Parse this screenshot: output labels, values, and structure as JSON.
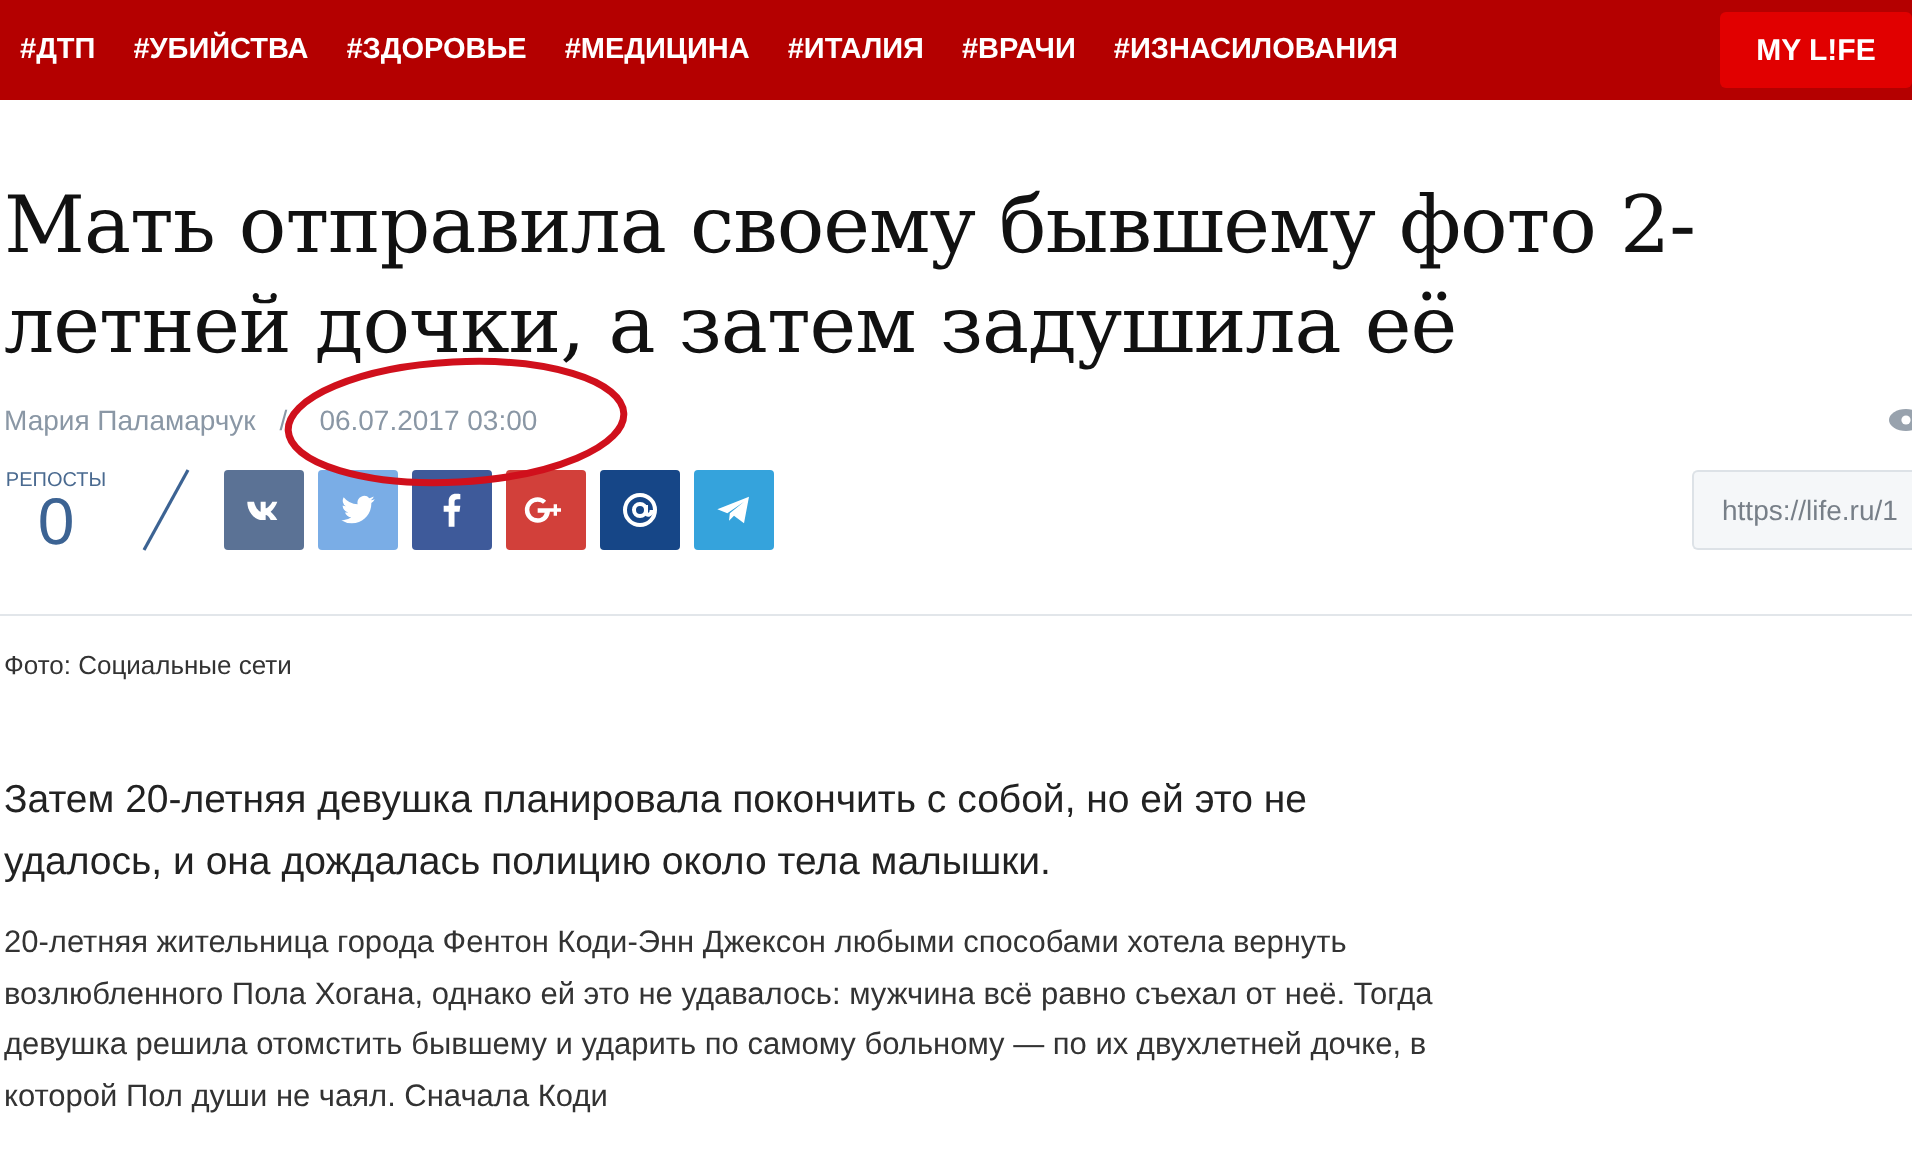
{
  "nav": {
    "tags": [
      "#ДТП",
      "#УБИЙСТВА",
      "#ЗДОРОВЬЕ",
      "#МЕДИЦИНА",
      "#ИТАЛИЯ",
      "#ВРАЧИ",
      "#ИЗНАСИЛОВАНИЯ"
    ],
    "brand_button": "MY L!FE"
  },
  "article": {
    "title": "Мать отправила своему бывшему фото 2-летней дочки, а затем задушила её",
    "author": "Мария Паламарчук",
    "separator": "/",
    "date": "06.07.2017 03:00",
    "date_highlighted": true,
    "reposts": {
      "label": "РЕПОСТЫ",
      "count": "0"
    },
    "share": [
      {
        "kind": "vk",
        "color": "#5b7295"
      },
      {
        "kind": "twitter",
        "color": "#7aade6"
      },
      {
        "kind": "facebook",
        "color": "#3e5a9a"
      },
      {
        "kind": "google",
        "color": "#d2403a"
      },
      {
        "kind": "mail",
        "color": "#164687"
      },
      {
        "kind": "telegram",
        "color": "#35a3dc"
      }
    ],
    "url": "https://life.ru/1",
    "photo_caption": "Фото: Социальные сети",
    "lead": "Затем 20-летняя девушка планировала покончить с собой, но ей это не удалось, и она дождалась полицию около тела малышки.",
    "body": "20-летняя жительница города Фентон Коди-Энн Джексон любыми способами хотела вернуть возлюбленного Пола Хогана, однако ей это не удавалось: мужчина всё равно съехал от неё. Тогда девушка решила отомстить бывшему и ударить по самому больному — по их двухлетней дочке, в которой Пол души не чаял. Сначала Коди"
  }
}
